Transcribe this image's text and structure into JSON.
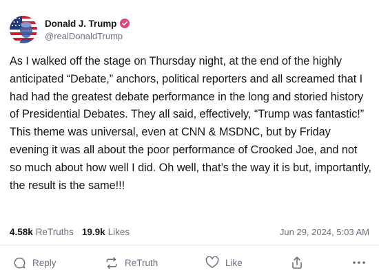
{
  "author": {
    "display_name": "Donald J. Trump",
    "handle": "@realDonaldTrump",
    "verified": true,
    "avatar_icon": "profile-avatar-flag-portrait"
  },
  "post": {
    "text": "As I walked off the stage on Thursday night, at the end of the highly anticipated “Debate,” anchors, political reporters and all screamed that I had had the greatest debate performance in the long and storied history of Presidential Debates. They all said, effectively, “Trump was fantastic!” This theme was universal, even at CNN & MSDNC, but by Friday evening it was all about the poor performance of Crooked Joe, and not so much about how well I did. Oh well, that’s the way it is but, importantly, the result is the same!!!"
  },
  "stats": {
    "retruths_count": "4.58k",
    "retruths_label": "ReTruths",
    "likes_count": "19.9k",
    "likes_label": "Likes",
    "timestamp": "Jun 29, 2024, 5:03 AM"
  },
  "actions": {
    "reply_label": "Reply",
    "retruth_label": "ReTruth",
    "like_label": "Like",
    "share_icon": "share-icon",
    "more_icon": "more-icon"
  },
  "colors": {
    "verified_badge": "#e0457b",
    "muted_text": "#6b6f80",
    "primary_text": "#16161d",
    "divider": "#e6e7ec"
  }
}
